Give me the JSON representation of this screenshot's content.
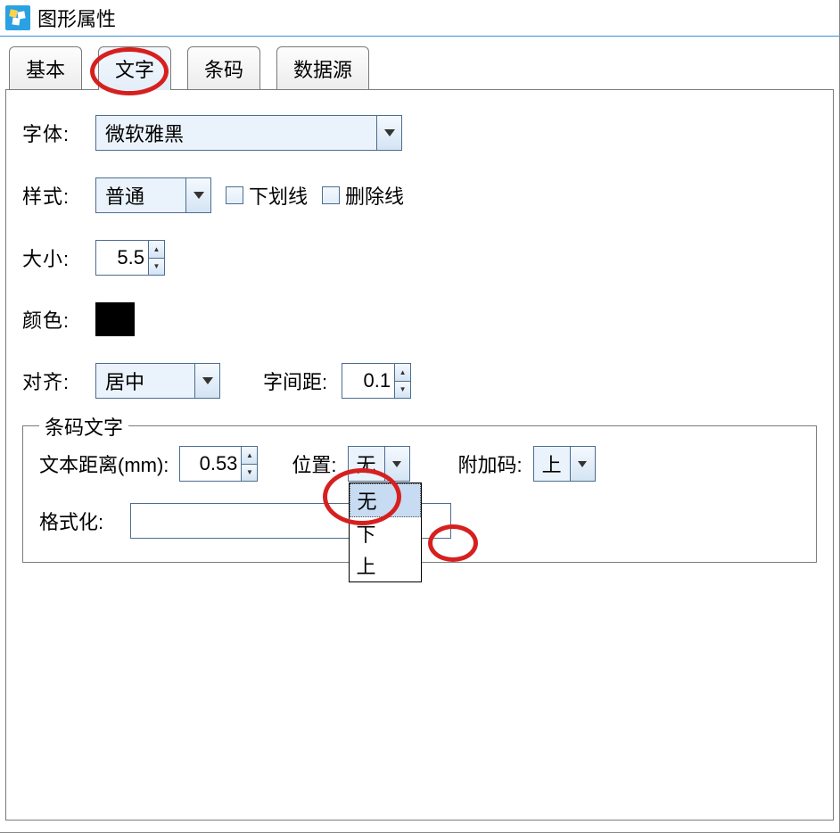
{
  "window": {
    "title": "图形属性"
  },
  "tabs": {
    "basic": "基本",
    "text": "文字",
    "barcode": "条码",
    "datasource": "数据源"
  },
  "labels": {
    "font": "字体:",
    "style": "样式:",
    "underline": "下划线",
    "strikeout": "删除线",
    "size": "大小:",
    "color": "颜色:",
    "align": "对齐:",
    "char_spacing": "字间距:",
    "group_title": "条码文字",
    "text_distance": "文本距离(mm):",
    "position": "位置:",
    "addon": "附加码:",
    "format": "格式化:"
  },
  "values": {
    "font": "微软雅黑",
    "style": "普通",
    "size": "5.5",
    "color": "#000000",
    "align": "居中",
    "char_spacing": "0.1",
    "text_distance": "0.53",
    "position": "无",
    "addon": "上",
    "format": ""
  },
  "position_options": [
    "无",
    "下",
    "上"
  ]
}
